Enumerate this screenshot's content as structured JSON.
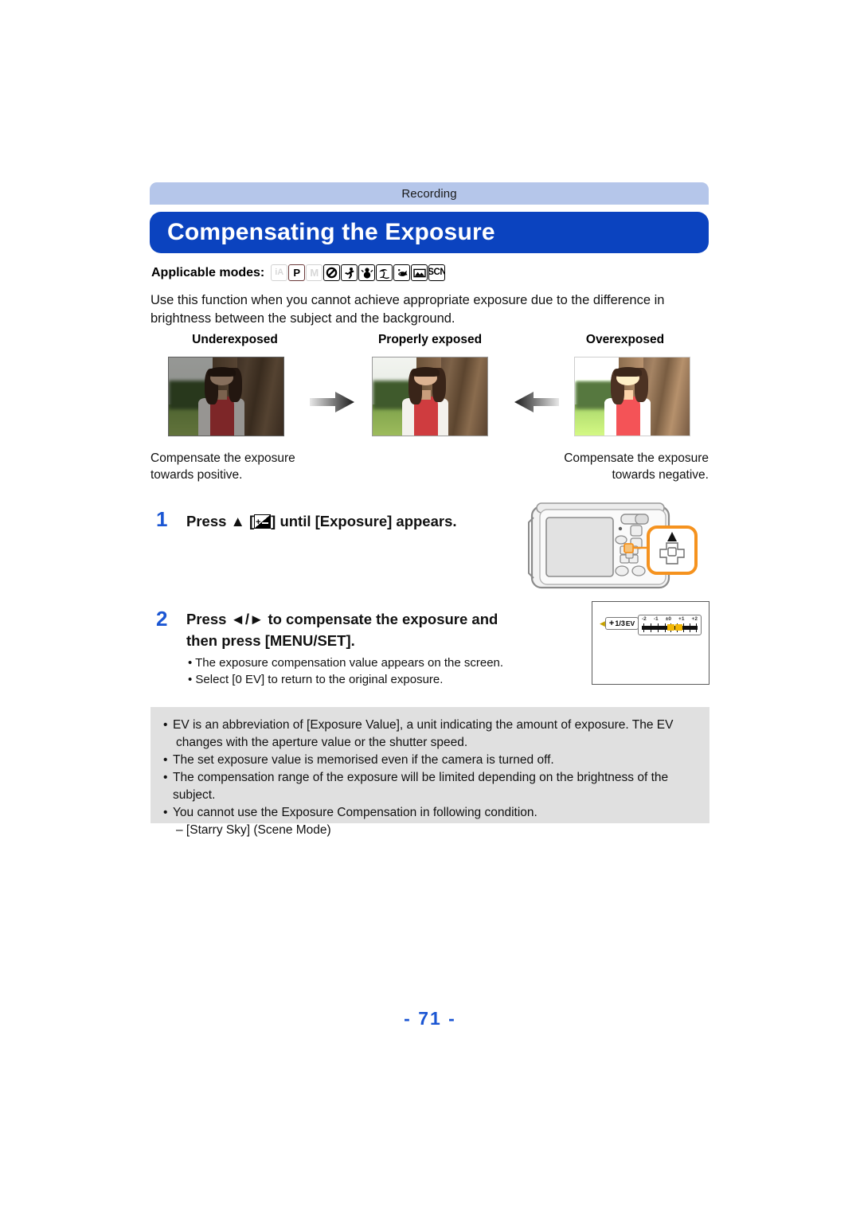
{
  "section": {
    "label": "Recording"
  },
  "title": {
    "text": "Compensating the Exposure"
  },
  "modes": {
    "label": "Applicable modes:",
    "items": [
      {
        "name": "intelligent-auto",
        "glyph": "iA",
        "active": false
      },
      {
        "name": "program-ae",
        "glyph": "P",
        "active": true
      },
      {
        "name": "manual",
        "glyph": "M",
        "active": false
      },
      {
        "name": "creative-control",
        "glyph": "circle-slash",
        "active": true
      },
      {
        "name": "sports",
        "glyph": "runner",
        "active": true
      },
      {
        "name": "snow",
        "glyph": "snowman",
        "active": true
      },
      {
        "name": "beach-surf",
        "glyph": "palm",
        "active": true
      },
      {
        "name": "underwater",
        "glyph": "fish",
        "active": true
      },
      {
        "name": "scenery",
        "glyph": "mountain",
        "active": true
      },
      {
        "name": "scene-mode",
        "glyph": "SCN",
        "active": true
      }
    ]
  },
  "intro": "Use this function when you cannot achieve appropriate exposure due to the difference in brightness between the subject and the background.",
  "samples": [
    {
      "caption": "Underexposed",
      "note": "Compensate the exposure towards positive."
    },
    {
      "caption": "Properly exposed",
      "note": ""
    },
    {
      "caption": "Overexposed",
      "note": "Compensate the exposure towards negative."
    }
  ],
  "steps": [
    {
      "number": "1",
      "head_before": "Press ▲ [",
      "head_after": "] until [Exposure] appears.",
      "bullets": []
    },
    {
      "number": "2",
      "head_line1": "Press ◄/► to compensate the exposure and",
      "head_line2": "then press [MENU/SET].",
      "bullets": [
        "• The exposure compensation value appears on the screen.",
        "• Select [0 EV] to return to the original exposure."
      ]
    }
  ],
  "screen": {
    "ev_sign": "+",
    "ev_fraction": "1/3",
    "ev_unit": "EV",
    "scale_labels": [
      "-2",
      "-1",
      "±0",
      "+1",
      "+2"
    ]
  },
  "notes": [
    {
      "bullet": "•",
      "text": "EV is an abbreviation of [Exposure Value], a unit indicating the amount of exposure. The EV",
      "cont": "changes with the aperture value or the shutter speed."
    },
    {
      "bullet": "•",
      "text": "The set exposure value is memorised even if the camera is turned off."
    },
    {
      "bullet": "•",
      "text": "The compensation range of the exposure will be limited depending on the brightness of the subject."
    },
    {
      "bullet": "•",
      "text": "You cannot use the Exposure Compensation in following condition.",
      "sub": "– [Starry Sky] (Scene Mode)"
    }
  ],
  "page_number": "- 71 -",
  "colors": {
    "section_bar": "#b5c6ea",
    "title_bar": "#0b43bf",
    "accent_blue": "#1b56d3",
    "note_box": "#e0e0e0",
    "callout_orange": "#f5921e",
    "marker_yellow": "#f2b705"
  }
}
